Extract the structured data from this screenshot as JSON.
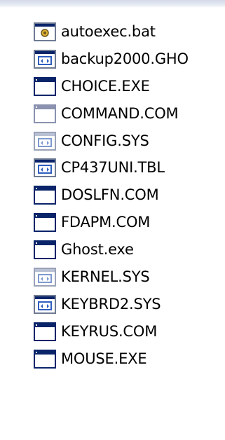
{
  "colors": {
    "window_titlebar": "#0a246a",
    "icon_border": "#6f7b93",
    "icon_fill": "#ffffff",
    "icon_blue": "#2f5fbf",
    "gear_yellow": "#e0b030",
    "top_strip": "#d4dae8"
  },
  "files": [
    {
      "name": "autoexec.bat",
      "icon": "batch-file-icon"
    },
    {
      "name": "backup2000.GHO",
      "icon": "system-file-icon"
    },
    {
      "name": "CHOICE.EXE",
      "icon": "dos-program-icon"
    },
    {
      "name": "COMMAND.COM",
      "icon": "dos-program-icon"
    },
    {
      "name": "CONFIG.SYS",
      "icon": "system-file-icon"
    },
    {
      "name": "CP437UNI.TBL",
      "icon": "system-file-icon"
    },
    {
      "name": "DOSLFN.COM",
      "icon": "dos-program-icon"
    },
    {
      "name": "FDAPM.COM",
      "icon": "dos-program-icon"
    },
    {
      "name": "Ghost.exe",
      "icon": "dos-program-icon"
    },
    {
      "name": "KERNEL.SYS",
      "icon": "system-file-icon"
    },
    {
      "name": "KEYBRD2.SYS",
      "icon": "system-file-icon"
    },
    {
      "name": "KEYRUS.COM",
      "icon": "dos-program-icon"
    },
    {
      "name": "MOUSE.EXE",
      "icon": "dos-program-icon"
    }
  ]
}
